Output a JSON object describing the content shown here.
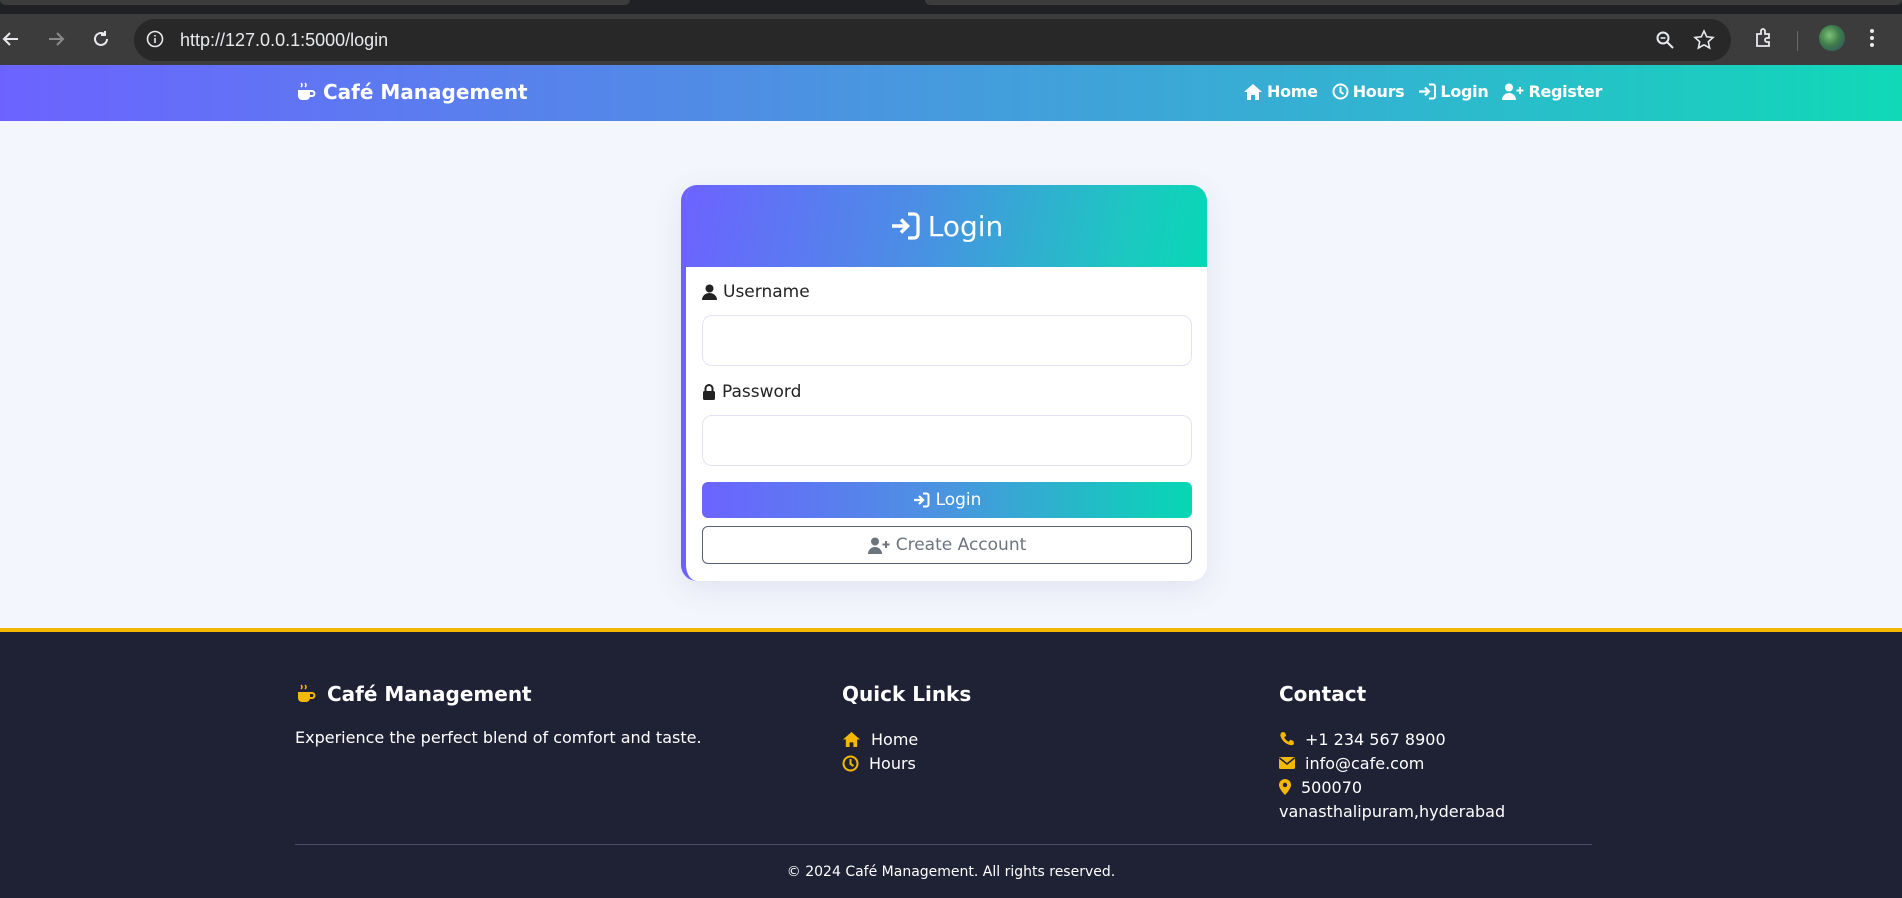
{
  "browser": {
    "url": "http://127.0.0.1:5000/login"
  },
  "navbar": {
    "brand": "Café Management",
    "links": [
      {
        "label": "Home",
        "icon": "home-icon"
      },
      {
        "label": "Hours",
        "icon": "clock-icon"
      },
      {
        "label": "Login",
        "icon": "sign-in-icon"
      },
      {
        "label": "Register",
        "icon": "user-plus-icon"
      }
    ]
  },
  "login_card": {
    "title": "Login",
    "username_label": "Username",
    "username_value": "",
    "password_label": "Password",
    "password_value": "",
    "login_button": "Login",
    "create_account_button": "Create Account"
  },
  "footer": {
    "brand": "Café Management",
    "tagline": "Experience the perfect blend of comfort and taste.",
    "quick_links_title": "Quick Links",
    "quick_links": [
      {
        "label": "Home",
        "icon": "home-icon"
      },
      {
        "label": "Hours",
        "icon": "clock-icon"
      }
    ],
    "contact_title": "Contact",
    "contact": {
      "phone": "+1 234 567 8900",
      "email": "info@cafe.com",
      "address_line1": "500070",
      "address_line2": "vanasthalipuram,hyderabad"
    },
    "copyright": "© 2024 Café Management. All rights reserved."
  },
  "colors": {
    "accent_gradient_start": "#6c63ff",
    "accent_gradient_end": "#08d7b6",
    "footer_bg": "#1f2235",
    "footer_accent": "#f5b800"
  }
}
